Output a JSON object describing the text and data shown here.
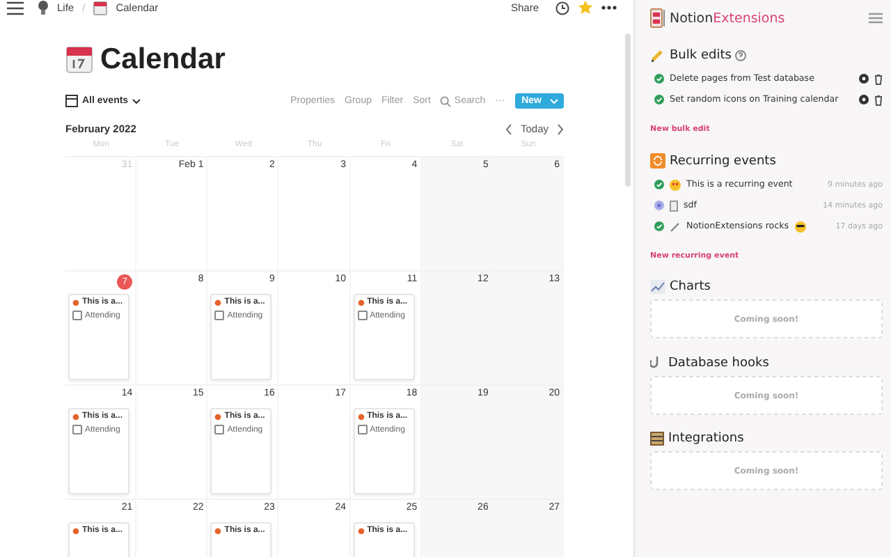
{
  "topbar": {
    "separator": "/",
    "breadcrumbs": [
      {
        "label": "Life"
      },
      {
        "label": "Calendar"
      }
    ],
    "share": "Share"
  },
  "page": {
    "title": "Calendar"
  },
  "toolbar": {
    "view": "All events",
    "actions": [
      "Properties",
      "Group",
      "Filter",
      "Sort"
    ],
    "search": "Search",
    "more": "···",
    "new": "New"
  },
  "month": {
    "title": "February 2022",
    "today": "Today"
  },
  "weekdays": [
    "Mon",
    "Tue",
    "Wed",
    "Thu",
    "Fri",
    "Sat",
    "Sun"
  ],
  "weeks": [
    [
      {
        "label": "31",
        "muted": true,
        "today": false
      },
      {
        "label": "Feb 1",
        "muted": false,
        "today": false
      },
      {
        "label": "2",
        "muted": false,
        "today": false
      },
      {
        "label": "3",
        "muted": false,
        "today": false
      },
      {
        "label": "4",
        "muted": false,
        "today": false
      },
      {
        "label": "5",
        "muted": false,
        "today": false
      },
      {
        "label": "6",
        "muted": false,
        "today": false
      }
    ],
    [
      {
        "label": "7",
        "muted": false,
        "today": true,
        "event": {
          "title": "This is a...",
          "checkbox_label": "Attending",
          "attending": false
        }
      },
      {
        "label": "8",
        "muted": false,
        "today": false
      },
      {
        "label": "9",
        "muted": false,
        "today": false,
        "event": {
          "title": "This is a...",
          "checkbox_label": "Attending",
          "attending": false
        }
      },
      {
        "label": "10",
        "muted": false,
        "today": false
      },
      {
        "label": "11",
        "muted": false,
        "today": false,
        "event": {
          "title": "This is a...",
          "checkbox_label": "Attending",
          "attending": false
        }
      },
      {
        "label": "12",
        "muted": false,
        "today": false
      },
      {
        "label": "13",
        "muted": false,
        "today": false
      }
    ],
    [
      {
        "label": "14",
        "muted": false,
        "today": false,
        "event": {
          "title": "This is a...",
          "checkbox_label": "Attending",
          "attending": false
        }
      },
      {
        "label": "15",
        "muted": false,
        "today": false
      },
      {
        "label": "16",
        "muted": false,
        "today": false,
        "event": {
          "title": "This is a...",
          "checkbox_label": "Attending",
          "attending": false
        }
      },
      {
        "label": "17",
        "muted": false,
        "today": false
      },
      {
        "label": "18",
        "muted": false,
        "today": false,
        "event": {
          "title": "This is a...",
          "checkbox_label": "Attending",
          "attending": false
        }
      },
      {
        "label": "19",
        "muted": false,
        "today": false
      },
      {
        "label": "20",
        "muted": false,
        "today": false
      }
    ],
    [
      {
        "label": "21",
        "muted": false,
        "today": false,
        "event": {
          "title": "This is a..."
        }
      },
      {
        "label": "22",
        "muted": false,
        "today": false
      },
      {
        "label": "23",
        "muted": false,
        "today": false,
        "event": {
          "title": "This is a..."
        }
      },
      {
        "label": "24",
        "muted": false,
        "today": false
      },
      {
        "label": "25",
        "muted": false,
        "today": false,
        "event": {
          "title": "This is a..."
        }
      },
      {
        "label": "26",
        "muted": false,
        "today": false
      },
      {
        "label": "27",
        "muted": false,
        "today": false
      }
    ]
  ],
  "extension": {
    "brand": "Notion",
    "brand_accent": "Extensions",
    "sections": [
      {
        "kind": "bulk",
        "title": "Bulk edits",
        "items": [
          {
            "text": "Delete pages from Test database",
            "active": true
          },
          {
            "text": "Set random icons on Training calendar",
            "active": true
          }
        ],
        "link": "New bulk edit"
      },
      {
        "kind": "recurring",
        "title": "Recurring events",
        "items": [
          {
            "text": "This is a recurring event",
            "time": "9 minutes ago",
            "active": true
          },
          {
            "text": "sdf",
            "time": "14 minutes ago",
            "active": false
          },
          {
            "text": "NotionExtensions rocks",
            "time": "17 days ago",
            "active": true
          }
        ],
        "link": "New recurring event"
      },
      {
        "kind": "soon",
        "title": "Charts",
        "note": "Coming soon!"
      },
      {
        "kind": "soon",
        "title": "Database hooks",
        "note": "Coming soon!"
      },
      {
        "kind": "soon",
        "title": "Integrations",
        "note": "Coming soon!"
      }
    ]
  }
}
